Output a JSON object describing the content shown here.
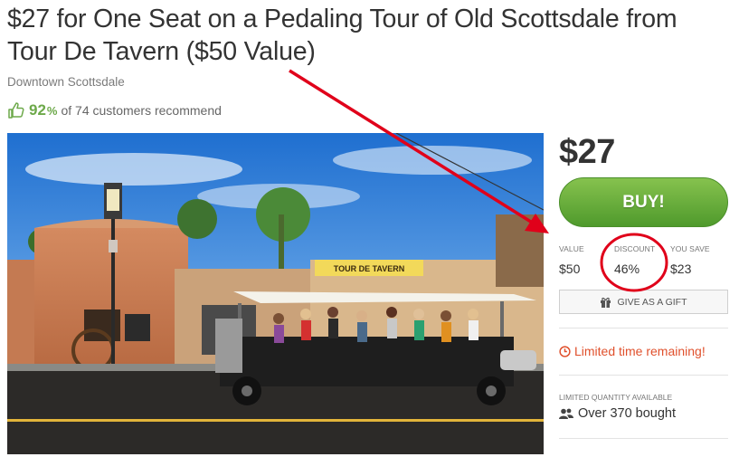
{
  "deal": {
    "title": "$27 for One Seat on a Pedaling Tour of Old Scottsdale from Tour De Tavern ($50 Value)",
    "location": "Downtown Scottsdale",
    "recommend_percent": "92",
    "recommend_percent_sign": "%",
    "recommend_text": "of 74 customers recommend",
    "image_sign_text": "TOUR DE TAVERN"
  },
  "purchase": {
    "price": "$27",
    "buy_label": "BUY!",
    "stats": [
      {
        "label": "VALUE",
        "value": "$50"
      },
      {
        "label": "DISCOUNT",
        "value": "46%"
      },
      {
        "label": "YOU SAVE",
        "value": "$23"
      }
    ],
    "gift_label": "GIVE AS A GIFT",
    "limited_text": "Limited time remaining!",
    "quantity_label": "LIMITED QUANTITY AVAILABLE",
    "bought_text": "Over 370 bought"
  },
  "icons": {
    "recommend": "thumbs-up-icon",
    "gift": "gift-icon",
    "limited": "clock-icon",
    "bought": "users-icon"
  },
  "colors": {
    "buy_button": "#5fa838",
    "recommend_green": "#6da94a",
    "limited_orange": "#e0502c",
    "annotation_red": "#e0001a"
  }
}
